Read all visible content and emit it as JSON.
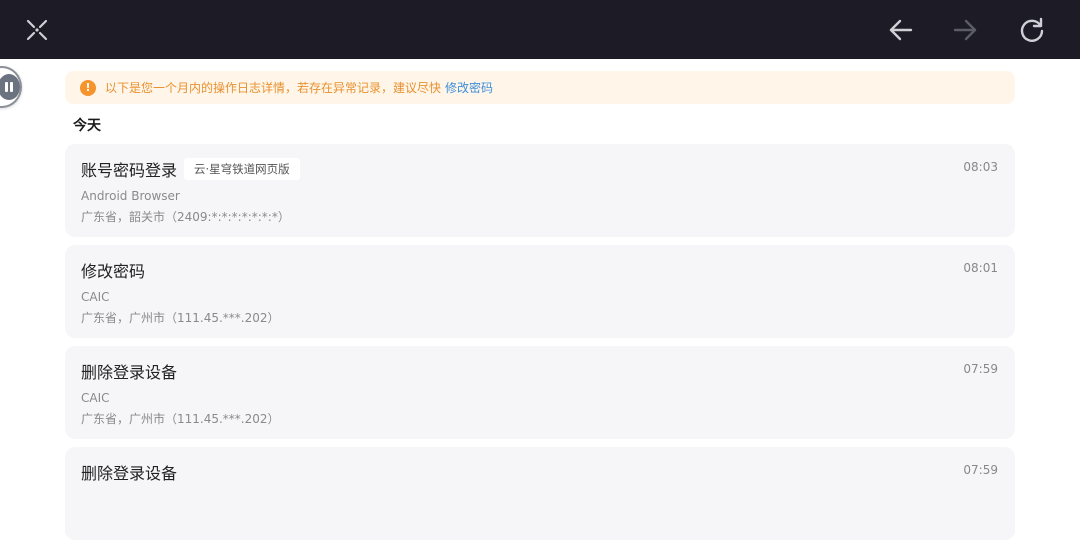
{
  "toolbar": {
    "close_icon": "close-x-icon",
    "back_icon": "arrow-left-icon",
    "forward_icon": "arrow-right-icon",
    "refresh_icon": "refresh-icon"
  },
  "notice": {
    "text": "以下是您一个月内的操作日志详情，若存在异常记录，建议尽快",
    "link": "修改密码"
  },
  "section_title": "今天",
  "logs": [
    {
      "title": "账号密码登录",
      "tag": "云·星穹铁道网页版",
      "time": "08:03",
      "device": "Android Browser",
      "location": "广东省，韶关市（2409:*:*:*:*:*:*:*）"
    },
    {
      "title": "修改密码",
      "tag": "",
      "time": "08:01",
      "device": "CAIC",
      "location": "广东省，广州市（111.45.***.202）"
    },
    {
      "title": "删除登录设备",
      "tag": "",
      "time": "07:59",
      "device": "CAIC",
      "location": "广东省，广州市（111.45.***.202）"
    },
    {
      "title": "删除登录设备",
      "tag": "",
      "time": "07:59",
      "device": "",
      "location": ""
    }
  ],
  "colors": {
    "topbar": "#1c1b26",
    "notice_bg": "#fff6e9",
    "notice_text": "#e8912f",
    "link": "#3d8fd9",
    "card_bg": "#f6f6f8"
  }
}
